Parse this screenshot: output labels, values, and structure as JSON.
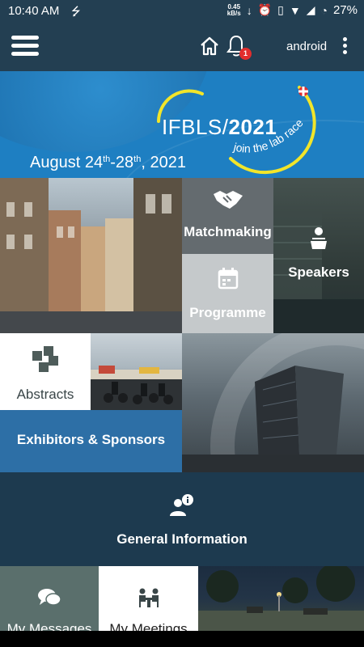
{
  "status_bar": {
    "time": "10:40 AM",
    "net_speed_value": "0.45",
    "net_speed_unit": "kB/s",
    "battery": "27%"
  },
  "app_bar": {
    "username": "android",
    "notification_count": "1"
  },
  "banner": {
    "logo_prefix": "IFBLS/",
    "logo_year": "2021",
    "tagline": "join the lab race",
    "dates": {
      "start": "August 24",
      "start_suffix": "th",
      "end": "-28",
      "end_suffix": "th",
      "year": ", 2021"
    }
  },
  "tiles": {
    "matchmaking": "Matchmaking",
    "speakers": "Speakers",
    "programme": "Programme",
    "abstracts": "Abstracts",
    "exhibitors": "Exhibitors & Sponsors",
    "general": "General Information",
    "messages": "My Messages",
    "meetings": "My Meetings"
  },
  "colors": {
    "app_bar": "#233f52",
    "banner": "#1e7fc2",
    "logo_accent": "#f2e52a",
    "exhibitors": "#2d6fa6",
    "badge": "#e22d2d"
  }
}
